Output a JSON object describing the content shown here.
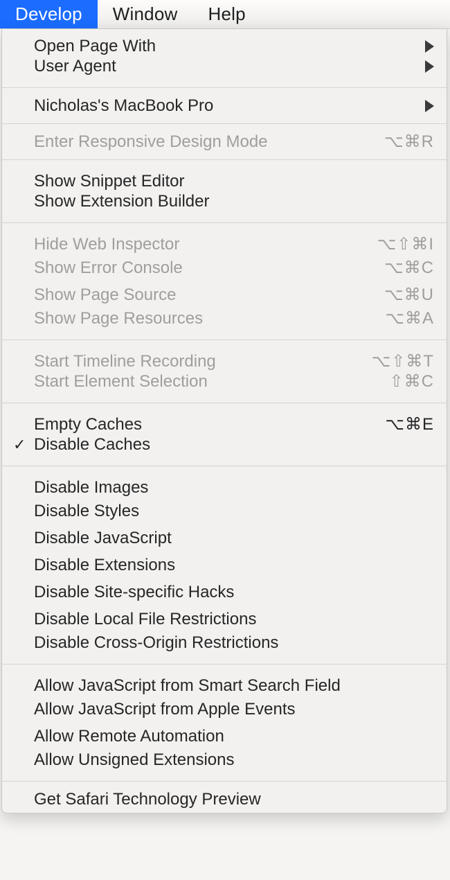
{
  "menubar": {
    "develop": "Develop",
    "window": "Window",
    "help": "Help"
  },
  "menu": {
    "open_page_with": "Open Page With",
    "user_agent": "User Agent",
    "device_name": "Nicholas's MacBook Pro",
    "responsive_mode": {
      "label": "Enter Responsive Design Mode",
      "shortcut": "⌥⌘R"
    },
    "snippet_editor": "Show Snippet Editor",
    "extension_builder": "Show Extension Builder",
    "hide_inspector": {
      "label": "Hide Web Inspector",
      "shortcut": "⌥⇧⌘I"
    },
    "error_console": {
      "label": "Show Error Console",
      "shortcut": "⌥⌘C"
    },
    "page_source": {
      "label": "Show Page Source",
      "shortcut": "⌥⌘U"
    },
    "page_resources": {
      "label": "Show Page Resources",
      "shortcut": "⌥⌘A"
    },
    "timeline": {
      "label": "Start Timeline Recording",
      "shortcut": "⌥⇧⌘T"
    },
    "element_selection": {
      "label": "Start Element Selection",
      "shortcut": "⇧⌘C"
    },
    "empty_caches": {
      "label": "Empty Caches",
      "shortcut": "⌥⌘E"
    },
    "disable_caches": "Disable Caches",
    "disable_images": "Disable Images",
    "disable_styles": "Disable Styles",
    "disable_js": "Disable JavaScript",
    "disable_ext": "Disable Extensions",
    "disable_hacks": "Disable Site-specific Hacks",
    "disable_local": "Disable Local File Restrictions",
    "disable_cors": "Disable Cross-Origin Restrictions",
    "allow_js_search": "Allow JavaScript from Smart Search Field",
    "allow_js_apple": "Allow JavaScript from Apple Events",
    "allow_remote": "Allow Remote Automation",
    "allow_unsigned": "Allow Unsigned Extensions",
    "tech_preview": "Get Safari Technology Preview"
  }
}
